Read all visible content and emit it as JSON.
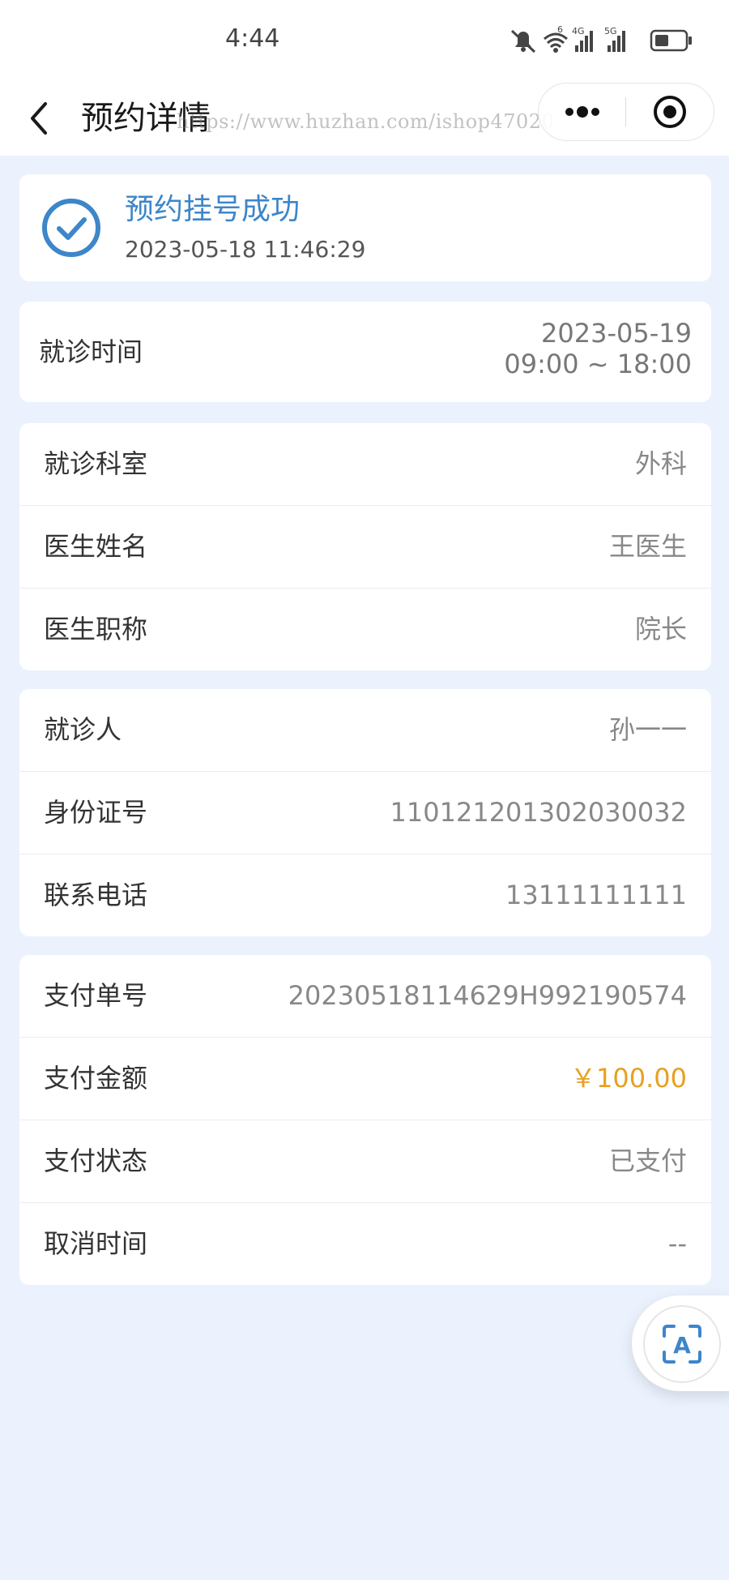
{
  "status_bar": {
    "time": "4:44",
    "network_labels": [
      "6",
      "4G",
      "5G"
    ]
  },
  "nav": {
    "title": "预约详情",
    "watermark": "https://www.huzhan.com/ishop47020"
  },
  "success": {
    "title": "预约挂号成功",
    "time": "2023-05-18 11:46:29",
    "accent_color": "#3d86c9"
  },
  "visit": {
    "label": "就诊时间",
    "date": "2023-05-19",
    "time_range": "09:00 ~ 18:00"
  },
  "doctor_info": [
    {
      "label": "就诊科室",
      "value": "外科"
    },
    {
      "label": "医生姓名",
      "value": "王医生"
    },
    {
      "label": "医生职称",
      "value": "院长"
    }
  ],
  "patient_info": [
    {
      "label": "就诊人",
      "value": "孙一一"
    },
    {
      "label": "身份证号",
      "value": "110121201302030032"
    },
    {
      "label": "联系电话",
      "value": "13111111111"
    }
  ],
  "payment_info": [
    {
      "label": "支付单号",
      "value": "20230518114629H992190574"
    },
    {
      "label": "支付金额",
      "value": "￥100.00",
      "color": "#e8a021"
    },
    {
      "label": "支付状态",
      "value": "已支付"
    },
    {
      "label": "取消时间",
      "value": "--"
    }
  ],
  "float_button": {
    "icon_letter": "A",
    "icon": "scan-text-icon"
  },
  "colors": {
    "page_bg": "#ebf2fd",
    "card_bg": "#ffffff",
    "amount": "#e8a021"
  }
}
